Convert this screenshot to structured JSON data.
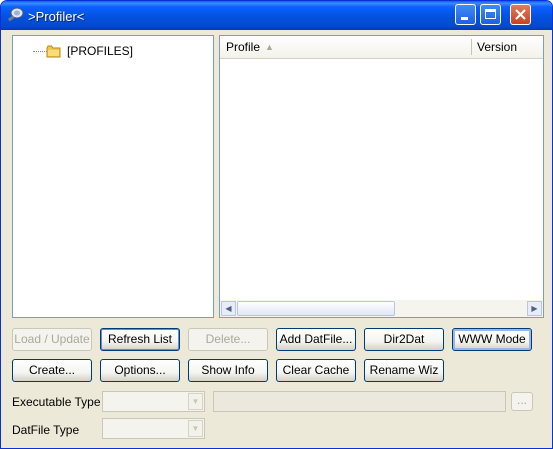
{
  "window": {
    "title": ">Profiler<"
  },
  "titlebar_buttons": {
    "minimize": "minimize-icon",
    "maximize": "maximize-icon",
    "close": "close-icon"
  },
  "tree": {
    "root_label": "[PROFILES]"
  },
  "listview": {
    "columns": [
      "Profile",
      "Version"
    ]
  },
  "buttons": {
    "row1": [
      {
        "label": "Load / Update",
        "enabled": false
      },
      {
        "label": "Refresh List",
        "enabled": true
      },
      {
        "label": "Delete...",
        "enabled": false
      },
      {
        "label": "Add DatFile...",
        "enabled": true
      },
      {
        "label": "Dir2Dat",
        "enabled": true
      },
      {
        "label": "WWW Mode",
        "enabled": true
      }
    ],
    "row2": [
      {
        "label": "Create...",
        "enabled": true
      },
      {
        "label": "Options...",
        "enabled": true
      },
      {
        "label": "Show Info",
        "enabled": true
      },
      {
        "label": "Clear Cache",
        "enabled": true
      },
      {
        "label": "Rename Wiz",
        "enabled": true
      }
    ],
    "browse": "..."
  },
  "fields": {
    "executable_type_label": "Executable Type",
    "executable_type_value": "",
    "executable_path_value": "",
    "datfile_type_label": "DatFile Type",
    "datfile_type_value": ""
  },
  "colors": {
    "titlebar": "#0553e2",
    "frame": "#ece9d8",
    "border": "#7f9db9"
  }
}
